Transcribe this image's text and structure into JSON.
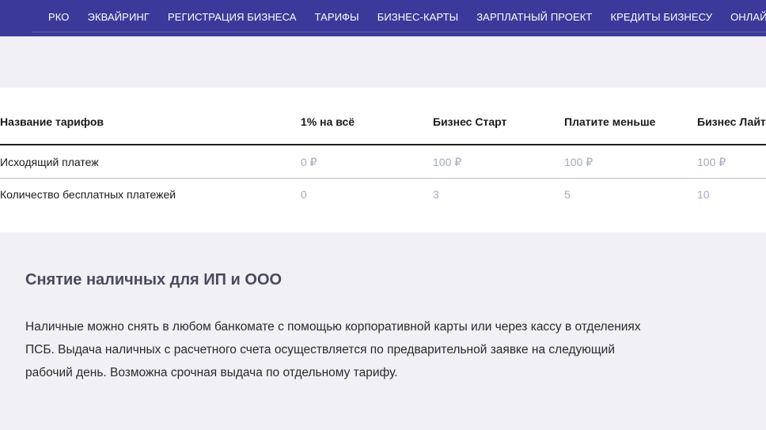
{
  "nav": {
    "items": [
      {
        "label": "РКО"
      },
      {
        "label": "ЭКВАЙРИНГ"
      },
      {
        "label": "РЕГИСТРАЦИЯ БИЗНЕСА"
      },
      {
        "label": "ТАРИФЫ"
      },
      {
        "label": "БИЗНЕС-КАРТЫ"
      },
      {
        "label": "ЗАРПЛАТНЫЙ ПРОЕКТ"
      },
      {
        "label": "КРЕДИТЫ БИЗНЕСУ"
      },
      {
        "label": "ОНЛАЙН-БУХГАЛТЕРИЯ"
      }
    ],
    "background": "#3b3a9a"
  },
  "tariff_table": {
    "headers": [
      "Название тарифов",
      "1% на всё",
      "Бизнес Старт",
      "Платите меньше",
      "Бизнес Лайт"
    ],
    "rows": [
      {
        "label": "Исходящий платеж",
        "values": [
          "0 ₽",
          "100 ₽",
          "100 ₽",
          "100 ₽"
        ]
      },
      {
        "label": "Количество бесплатных платежей",
        "values": [
          "0",
          "3",
          "5",
          "10"
        ]
      }
    ],
    "value_color": "#a3a8bd"
  },
  "section": {
    "title": "Снятие наличных для ИП и ООО",
    "text": "Наличные можно снять в любом банкомате с помощью корпоративной карты или через кассу в отделениях ПСБ. Выдача наличных с расчетного счета осуществляется по предварительной заявке на следующий рабочий день. Возможна срочная выдача по отдельному тарифу."
  }
}
